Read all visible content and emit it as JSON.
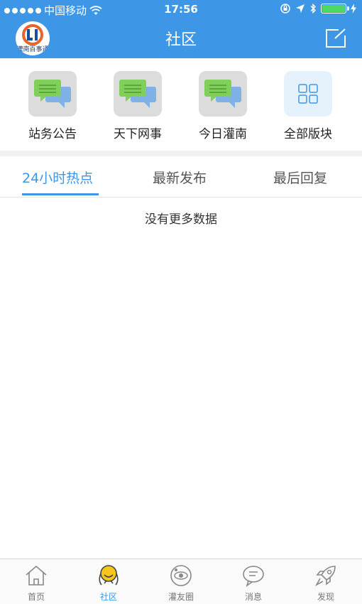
{
  "status_bar": {
    "carrier": "中国移动",
    "time": "17:56"
  },
  "header": {
    "title": "社区",
    "logo_text": "灌南百事通"
  },
  "categories": [
    {
      "label": "站务公告",
      "icon": "chat-bubbles-icon"
    },
    {
      "label": "天下网事",
      "icon": "chat-bubbles-icon"
    },
    {
      "label": "今日灌南",
      "icon": "chat-bubbles-icon"
    },
    {
      "label": "全部版块",
      "icon": "grid-icon"
    }
  ],
  "tabs": [
    {
      "label": "24小时热点",
      "active": true
    },
    {
      "label": "最新发布",
      "active": false
    },
    {
      "label": "最后回复",
      "active": false
    }
  ],
  "content": {
    "empty_message": "没有更多数据"
  },
  "bottom_nav": [
    {
      "label": "首页",
      "icon": "home-icon",
      "active": false
    },
    {
      "label": "社区",
      "icon": "community-mascot-icon",
      "active": true
    },
    {
      "label": "灌友圈",
      "icon": "planet-icon",
      "active": false
    },
    {
      "label": "消息",
      "icon": "message-icon",
      "active": false
    },
    {
      "label": "发现",
      "icon": "rocket-icon",
      "active": false
    }
  ],
  "colors": {
    "primary": "#3d96e6",
    "battery": "#4cd964",
    "chat_green": "#7fcf5a",
    "chat_blue": "#7fb1e6"
  }
}
